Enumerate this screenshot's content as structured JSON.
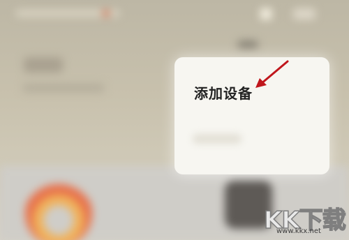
{
  "popup": {
    "add_device_label": "添加设备"
  },
  "watermark": {
    "logo_text": "KK下载",
    "url": "www.kkx.net"
  },
  "colors": {
    "background": "#c8c1ad",
    "popup": "#f7f6f1",
    "arrow": "#c0161c",
    "label": "#222222"
  },
  "icons": {
    "top_right_square": "square-icon",
    "top_right_menu": "menu-icon",
    "annotation": "arrow-icon"
  }
}
